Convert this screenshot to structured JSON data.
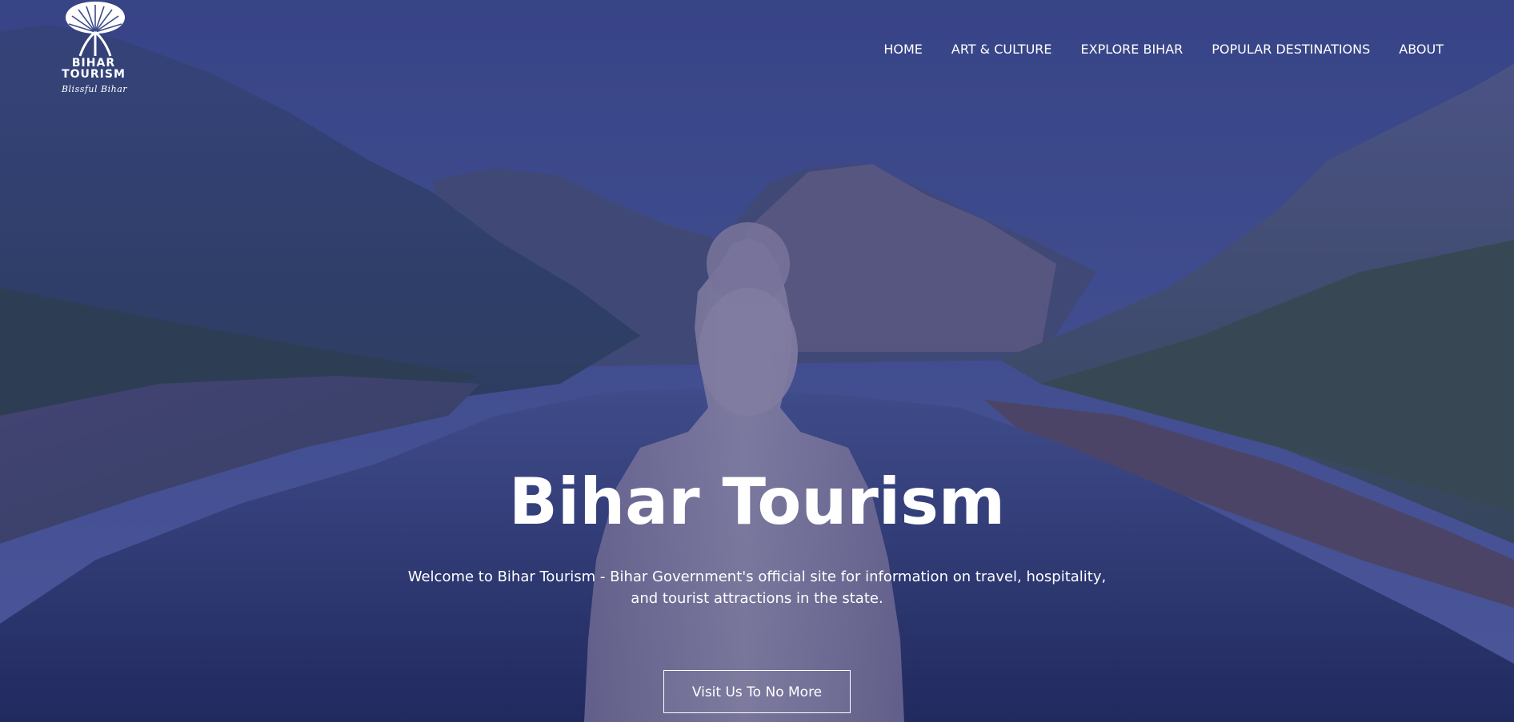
{
  "brand": {
    "name_line1": "BIHAR",
    "name_line2": "TOURISM",
    "tagline": "Blissful Bihar",
    "logo_icon": "bodhi-tree-icon"
  },
  "nav": {
    "items": [
      {
        "label": "HOME"
      },
      {
        "label": "ART & CULTURE"
      },
      {
        "label": "EXPLORE BIHAR"
      },
      {
        "label": "POPULAR DESTINATIONS"
      },
      {
        "label": "ABOUT"
      }
    ]
  },
  "hero": {
    "title": "Bihar Tourism",
    "description": "Welcome to Bihar Tourism - Bihar Government's official site for information on travel, hospitality, and tourist attractions in the state.",
    "cta_label": "Visit Us To No More",
    "background_image": "buddha-statue-river-valley"
  },
  "colors": {
    "overlay": "#2c3880",
    "text": "#ffffff"
  }
}
